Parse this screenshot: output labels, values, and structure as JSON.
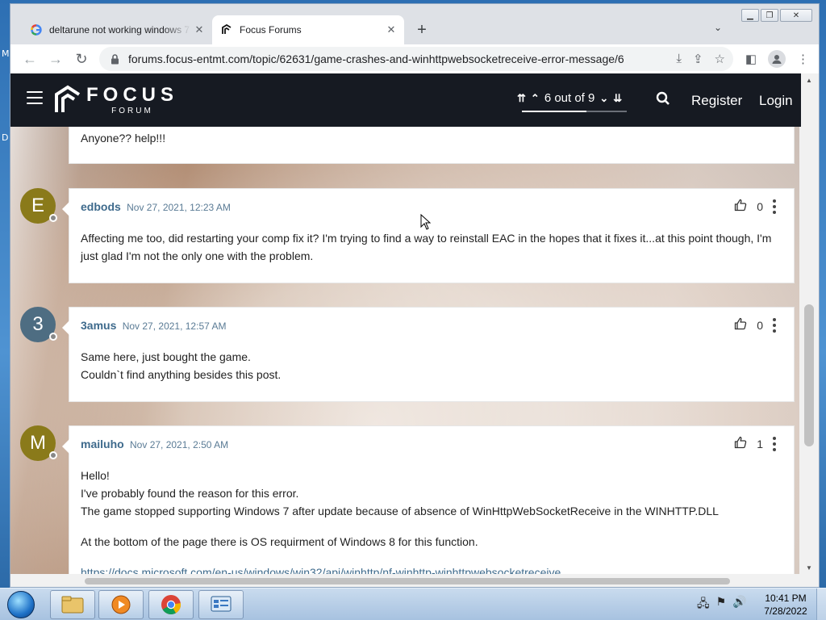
{
  "browser": {
    "tabs": [
      {
        "title": "deltarune not working windows 7",
        "favicon": "google-icon"
      },
      {
        "title": "Focus Forums",
        "favicon": "focus-icon"
      }
    ],
    "url": "forums.focus-entmt.com/topic/62631/game-crashes-and-winhttpwebsocketreceive-error-message/6"
  },
  "site": {
    "logo_main": "FOCUS",
    "logo_sub": "FORUM",
    "pager": "6 out of 9",
    "register": "Register",
    "login": "Login"
  },
  "previous_post": {
    "text": "Anyone?? help!!!"
  },
  "posts": [
    {
      "initial": "E",
      "avatar_color": "#8a7a1a",
      "author": "edbods",
      "date": "Nov 27, 2021, 12:23 AM",
      "votes": "0",
      "lines": [
        "Affecting me too, did restarting your comp fix it? I'm trying to find a way to reinstall EAC in the hopes that it fixes it...at this point though, I'm just glad I'm not the only one with the problem."
      ]
    },
    {
      "initial": "3",
      "avatar_color": "#4e6d82",
      "author": "3amus",
      "date": "Nov 27, 2021, 12:57 AM",
      "votes": "0",
      "lines": [
        "Same here, just bought the game.",
        "Couldn`t find anything besides this post."
      ]
    },
    {
      "initial": "M",
      "avatar_color": "#8a7a1a",
      "author": "mailuho",
      "date": "Nov 27, 2021, 2:50 AM",
      "votes": "1",
      "lines": [
        "Hello!",
        "I've probably found the reason for this error.",
        "The game stopped supporting Windows 7 after update because of absence of WinHttpWebSocketReceive in the WINHTTP.DLL",
        "At the bottom of the page there is OS requirment of Windows 8 for this function.",
        "https://docs.microsoft.com/en-us/windows/win32/api/winhttp/nf-winhttp-winhttpwebsocketreceive"
      ]
    }
  ],
  "taskbar": {
    "time": "10:41 PM",
    "date": "7/28/2022"
  },
  "desktop_glyphs": [
    "M",
    "D"
  ],
  "colors": {
    "site_bar": "#161a22",
    "author_link": "#3e6a8c"
  }
}
